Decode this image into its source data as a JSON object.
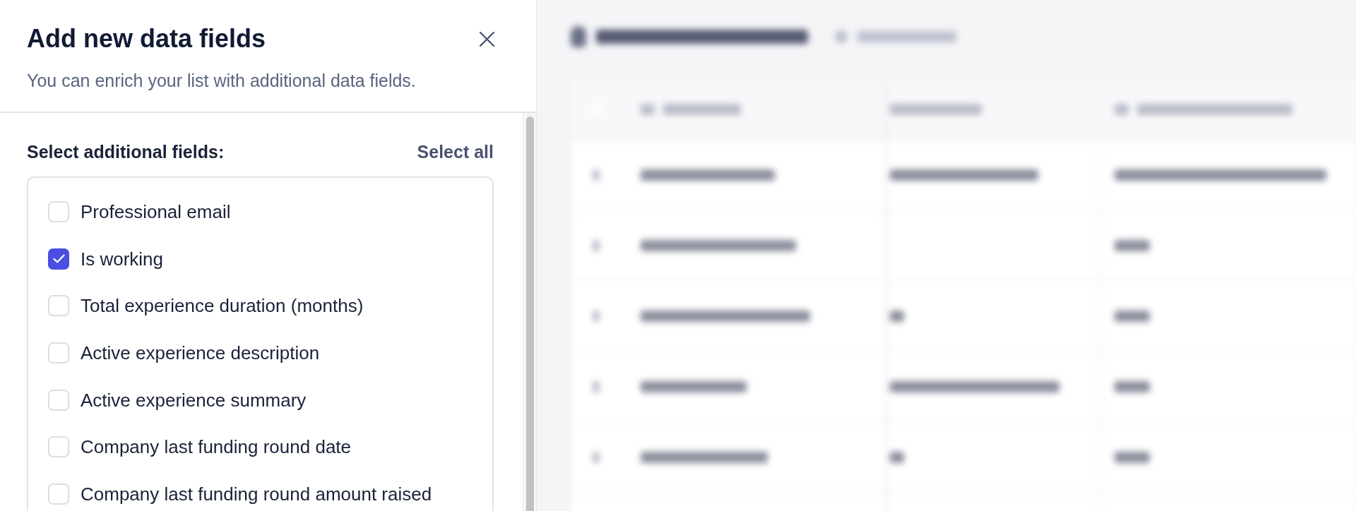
{
  "panel": {
    "title": "Add new data fields",
    "subtitle": "You can enrich your list with additional data fields."
  },
  "field_list": {
    "heading": "Select additional fields:",
    "select_all": "Select all",
    "items": [
      {
        "label": "Professional email",
        "checked": false
      },
      {
        "label": "Is working",
        "checked": true
      },
      {
        "label": "Total experience duration (months)",
        "checked": false
      },
      {
        "label": "Active experience description",
        "checked": false
      },
      {
        "label": "Active experience summary",
        "checked": false
      },
      {
        "label": "Company last funding round date",
        "checked": false
      },
      {
        "label": "Company last funding round amount raised",
        "checked": false
      }
    ]
  }
}
